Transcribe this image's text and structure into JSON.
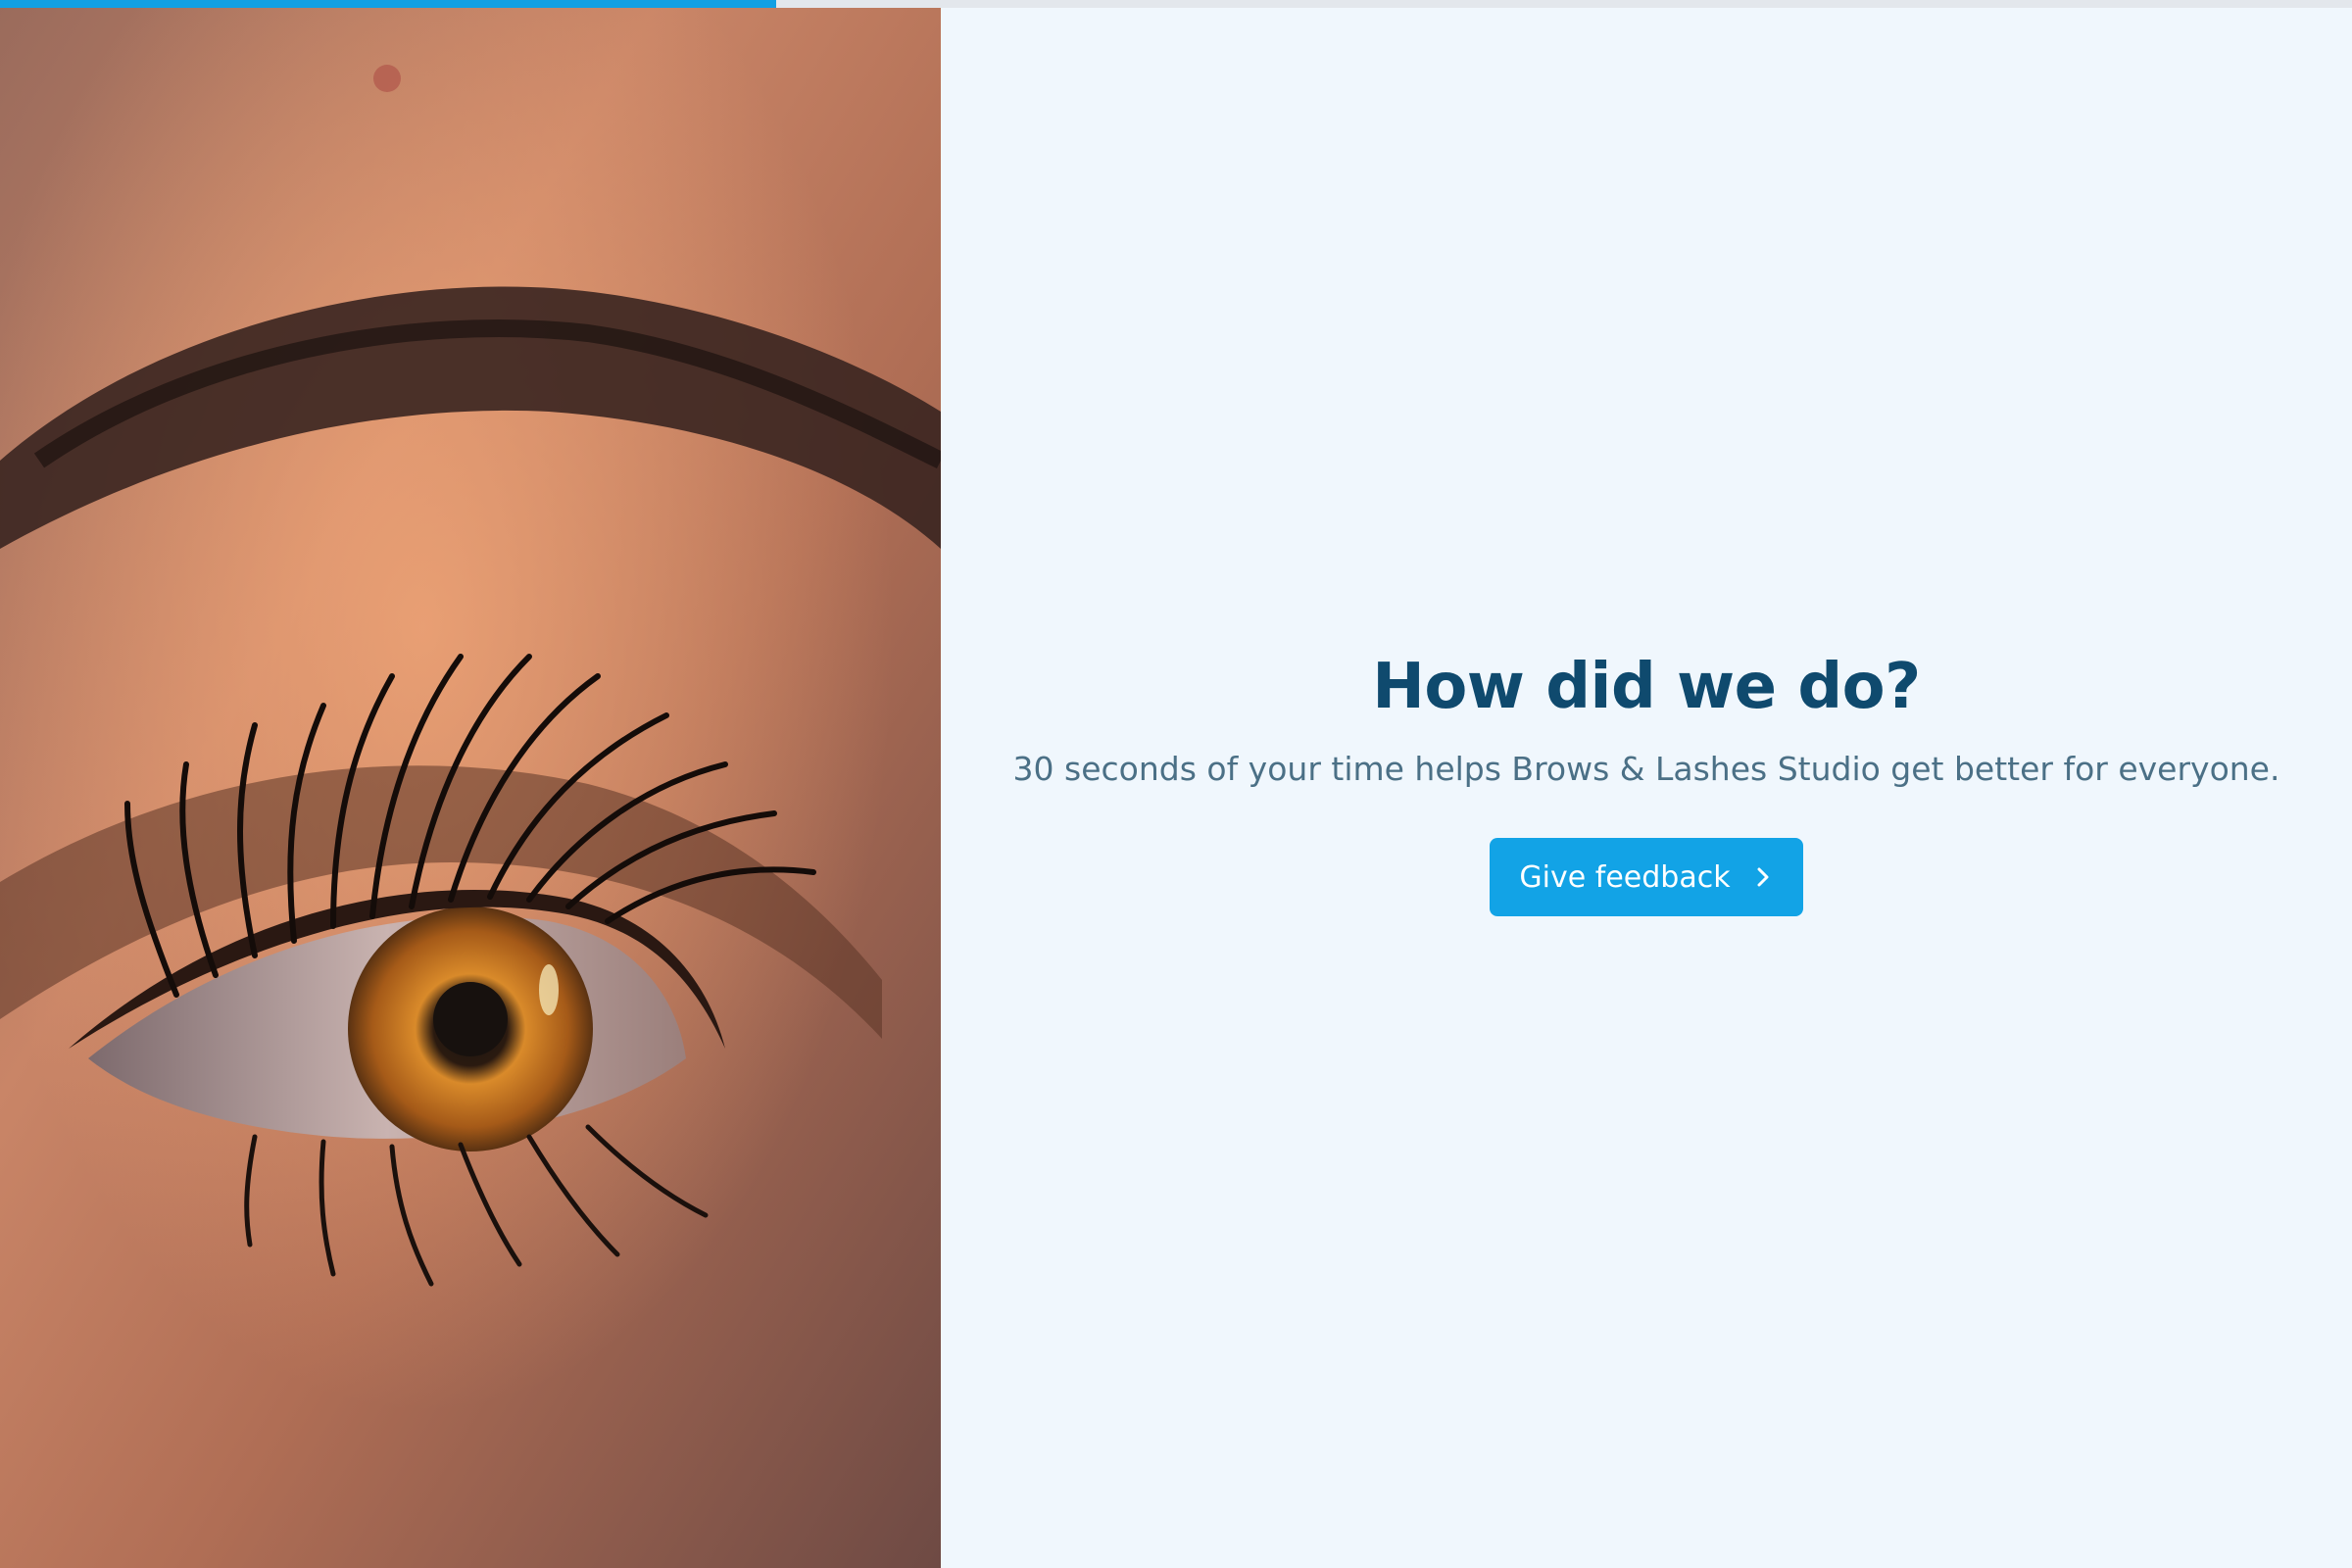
{
  "progress": {
    "value": 0.33
  },
  "photo": {
    "subject": "close-up eye photo"
  },
  "survey": {
    "heading": "How did we do?",
    "subtitle": "30 seconds of your time helps Brows & Lashes Studio get better for everyone.",
    "button_label": "Give feedback",
    "button_icon": "chevron-right-icon"
  },
  "colors": {
    "accent": "#12a3e6",
    "heading": "#0f4a6e",
    "subtitle": "#4b7086",
    "background": "#f0f7fd"
  }
}
